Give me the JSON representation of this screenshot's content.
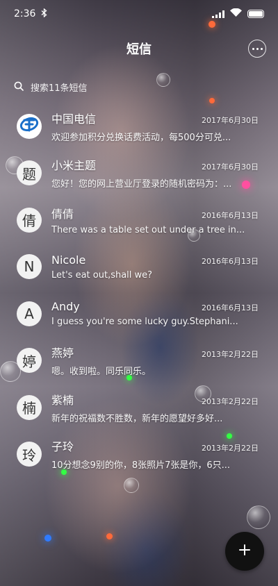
{
  "status_bar": {
    "time": "2:36"
  },
  "header": {
    "title": "短信"
  },
  "search": {
    "placeholder": "搜索11条短信"
  },
  "threads": [
    {
      "avatar": "",
      "avatar_icon": "china-telecom-logo",
      "name": "中国电信",
      "date": "2017年6月30日",
      "preview": "欢迎参加积分兑换话费活动，每500分可兑..."
    },
    {
      "avatar": "题",
      "name": "小米主题",
      "date": "2017年6月30日",
      "preview": "您好！您的网上营业厅登录的随机密码为：..."
    },
    {
      "avatar": "倩",
      "name": "倩倩",
      "date": "2016年6月13日",
      "preview": "There was a table set out under a tree in..."
    },
    {
      "avatar": "N",
      "name": "Nicole",
      "date": "2016年6月13日",
      "preview": "Let's eat out,shall we?"
    },
    {
      "avatar": "A",
      "name": "Andy",
      "date": "2016年6月13日",
      "preview": "I guess you're some lucky guy.Stephani..."
    },
    {
      "avatar": "婷",
      "name": "燕婷",
      "date": "2013年2月22日",
      "preview": "嗯。收到啦。同乐同乐。"
    },
    {
      "avatar": "楠",
      "name": "紫楠",
      "date": "2013年2月22日",
      "preview": "新年的祝福数不胜数，新年的愿望好多好..."
    },
    {
      "avatar": "玲",
      "name": "子玲",
      "date": "2013年2月22日",
      "preview": "10分想念9别的你，8张照片7张是你，6只..."
    }
  ],
  "colors": {
    "telecom_blue": "#1a6fc9",
    "fab_bg": "#111111"
  },
  "icons": {
    "bluetooth": "bluetooth-icon",
    "wifi": "wifi-icon",
    "more": "more-icon",
    "search": "search-icon",
    "compose": "plus-icon"
  }
}
